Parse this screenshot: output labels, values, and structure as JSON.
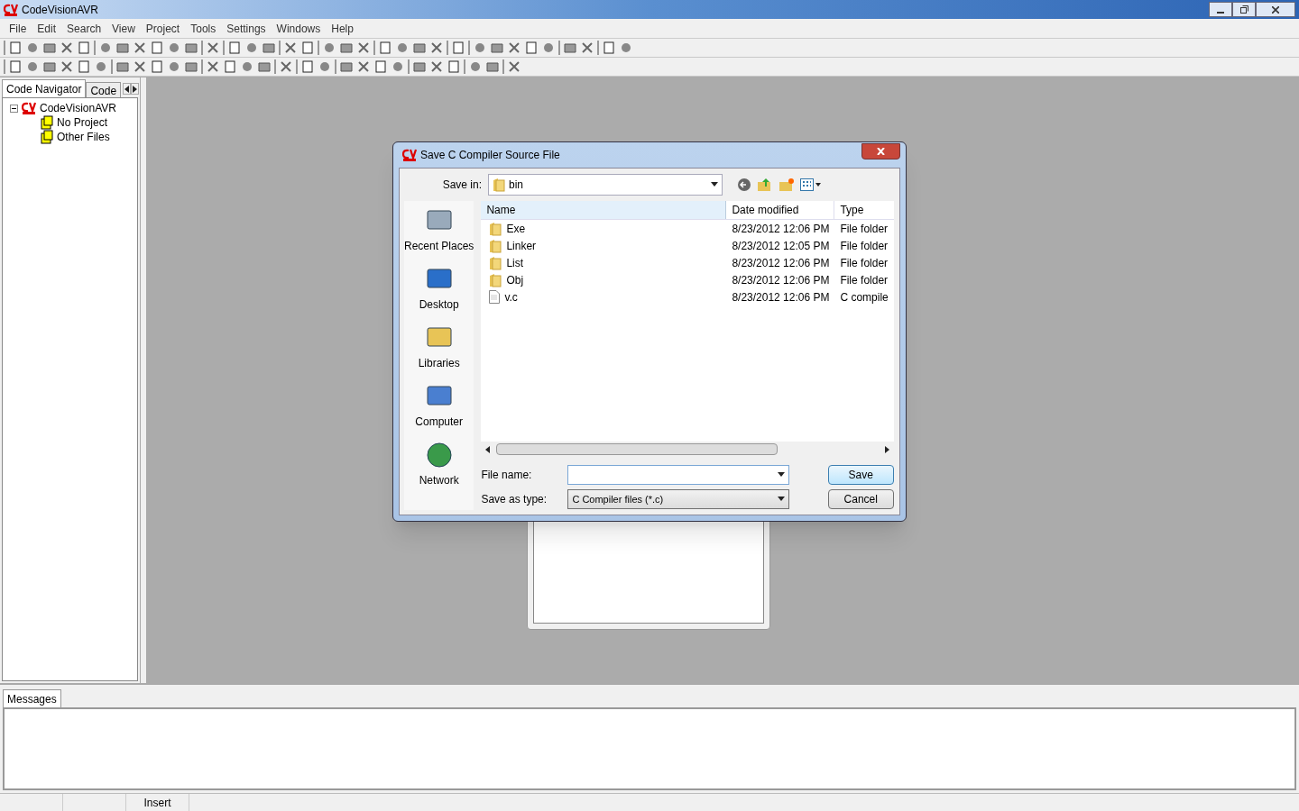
{
  "window": {
    "title": "CodeVisionAVR"
  },
  "menu": [
    "File",
    "Edit",
    "Search",
    "View",
    "Project",
    "Tools",
    "Settings",
    "Windows",
    "Help"
  ],
  "navigator": {
    "tabs": [
      {
        "label": "Code Navigator",
        "selected": true
      },
      {
        "label": "Code",
        "selected": false
      }
    ],
    "tree": [
      {
        "label": "CodeVisionAVR",
        "kind": "root",
        "expanded": true,
        "children": [
          {
            "label": "No Project",
            "kind": "folder"
          },
          {
            "label": "Other Files",
            "kind": "folder"
          }
        ]
      }
    ]
  },
  "dialog": {
    "title": "Save C Compiler Source File",
    "save_in_label": "Save in:",
    "save_in_value": "bin",
    "places": [
      "Recent Places",
      "Desktop",
      "Libraries",
      "Computer",
      "Network"
    ],
    "columns": [
      "Name",
      "Date modified",
      "Type"
    ],
    "rows": [
      {
        "name": "Exe",
        "kind": "folder",
        "date": "8/23/2012 12:06 PM",
        "type": "File folder"
      },
      {
        "name": "Linker",
        "kind": "folder",
        "date": "8/23/2012 12:05 PM",
        "type": "File folder"
      },
      {
        "name": "List",
        "kind": "folder",
        "date": "8/23/2012 12:06 PM",
        "type": "File folder"
      },
      {
        "name": "Obj",
        "kind": "folder",
        "date": "8/23/2012 12:06 PM",
        "type": "File folder"
      },
      {
        "name": "v.c",
        "kind": "file",
        "date": "8/23/2012 12:06 PM",
        "type": "C compile"
      }
    ],
    "file_name_label": "File name:",
    "save_type_label": "Save as type:",
    "save_type_value": "C Compiler files (*.c)",
    "buttons": [
      "Save",
      "Cancel"
    ]
  },
  "messages": {
    "tabs": [
      {
        "label": "Messages",
        "selected": true
      }
    ]
  },
  "status_bar": [
    {
      "label": "Insert"
    }
  ]
}
